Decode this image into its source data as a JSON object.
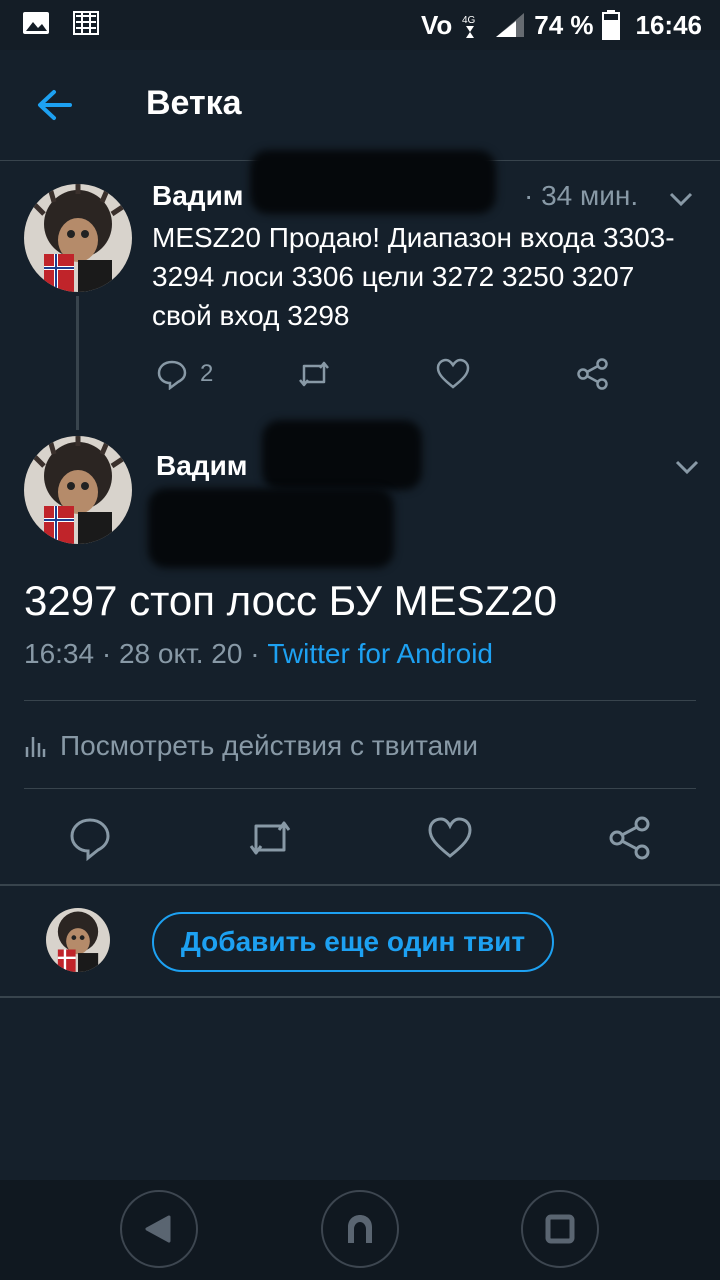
{
  "status_bar": {
    "carrier_label": "Vo",
    "network": "4G",
    "battery": "74 %",
    "time": "16:46"
  },
  "header": {
    "title": "Ветка"
  },
  "tweet1": {
    "author": "Вадим",
    "time": "· 34 мин.",
    "text": "MESZ20 Продаю! Диапазон входа 3303-3294 лоси 3306 цели 3272 3250 3207 свой вход 3298",
    "reply_count": "2"
  },
  "tweet2": {
    "author": "Вадим",
    "text": "3297 стоп лосс БУ MESZ20",
    "meta_time": "16:34 · 28 окт. 20 · ",
    "source": "Twitter for Android",
    "activity_label": "Посмотреть действия с твитами"
  },
  "reply": {
    "button_label": "Добавить еще один твит"
  },
  "icons": {
    "back": "arrow-left-icon",
    "reply": "speech-bubble-icon",
    "retweet": "retweet-icon",
    "like": "heart-icon",
    "share": "share-icon"
  },
  "colors": {
    "background": "#15202b",
    "accent": "#1da1f2",
    "secondary_text": "#8899a6",
    "divider": "#38444d"
  }
}
